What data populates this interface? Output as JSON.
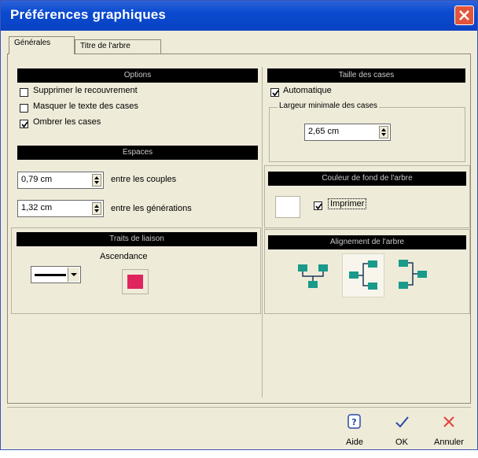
{
  "window": {
    "title": "Préférences graphiques"
  },
  "tabs": [
    {
      "label": "Générales",
      "active": true
    },
    {
      "label": "Titre de l'arbre",
      "active": false
    }
  ],
  "options": {
    "header": "Options",
    "items": [
      {
        "label": "Supprimer le recouvrement",
        "checked": false
      },
      {
        "label": "Masquer le texte des cases",
        "checked": false
      },
      {
        "label": "Ombrer les cases",
        "checked": true
      }
    ]
  },
  "espaces": {
    "header": "Espaces",
    "couples": {
      "value": "0,79 cm",
      "label": "entre les couples"
    },
    "generations": {
      "value": "1,32 cm",
      "label": "entre les générations"
    }
  },
  "traits": {
    "header": "Traits de liaison",
    "ascendance_label": "Ascendance",
    "color": "#e0245e"
  },
  "taille": {
    "header": "Taille des cases",
    "automatique": {
      "label": "Automatique",
      "checked": true
    },
    "largeur_label": "Largeur minimale des cases",
    "largeur_value": "2,65 cm"
  },
  "couleur": {
    "header": "Couleur de fond de l'arbre",
    "imprimer": {
      "label": "Imprimer",
      "checked": true
    }
  },
  "alignement": {
    "header": "Alignement de l'arbre"
  },
  "footer": {
    "aide": "Aide",
    "ok": "OK",
    "annuler": "Annuler"
  },
  "colors": {
    "accent": "#0a4ad0",
    "teal": "#1a9a8a",
    "close": "#e2553a"
  }
}
